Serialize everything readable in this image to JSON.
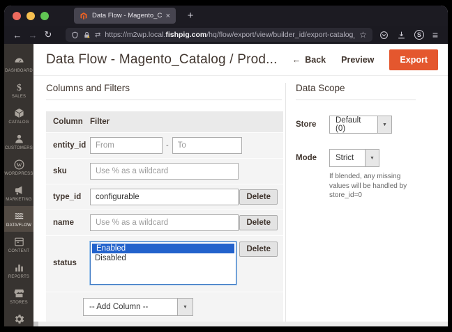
{
  "browser": {
    "tab_title": "Data Flow - Magento_Catalog / ...",
    "tab_close": "×",
    "new_tab": "+",
    "back": "←",
    "forward": "→",
    "reload": "↻",
    "exchange": "⇄",
    "url_prefix": "https://m2wp.local.",
    "url_domain": "fishpig.com",
    "url_path": "/hq/flow/export/view/builder_id/export-catalog_product/key/",
    "bookmark_star": "☆",
    "extension_s": "S",
    "menu": "≡"
  },
  "sidebar": {
    "items": [
      {
        "label": "DASHBOARD"
      },
      {
        "label": "SALES"
      },
      {
        "label": "CATALOG"
      },
      {
        "label": "CUSTOMERS"
      },
      {
        "label": "WORDPRESS"
      },
      {
        "label": "MARKETING"
      },
      {
        "label": "DATA/FLOW",
        "active": true
      },
      {
        "label": "CONTENT"
      },
      {
        "label": "REPORTS"
      },
      {
        "label": "STORES"
      },
      {
        "label": "SYSTEM"
      }
    ]
  },
  "header": {
    "title": "Data Flow - Magento_Catalog / Prod...",
    "back_arrow": "←",
    "back": "Back",
    "preview": "Preview",
    "export": "Export"
  },
  "columns": {
    "title": "Columns and Filters",
    "col_header": "Column",
    "filter_header": "Filter",
    "rows": {
      "entity_id": {
        "label": "entity_id",
        "from_placeholder": "From",
        "separator": "-",
        "to_placeholder": "To"
      },
      "sku": {
        "label": "sku",
        "placeholder": "Use % as a wildcard"
      },
      "type_id": {
        "label": "type_id",
        "value": "configurable",
        "delete": "Delete"
      },
      "name": {
        "label": "name",
        "placeholder": "Use % as a wildcard",
        "delete": "Delete"
      },
      "status": {
        "label": "status",
        "options": [
          "Enabled",
          "Disabled"
        ],
        "selected": "Enabled",
        "delete": "Delete"
      }
    },
    "add_column": "-- Add Column --",
    "dropdown_arrow": "▼"
  },
  "data_scope": {
    "title": "Data Scope",
    "store_label": "Store",
    "store_value": "Default (0)",
    "mode_label": "Mode",
    "mode_value": "Strict",
    "mode_help": "If blended, any missing values will be handled by store_id=0",
    "dropdown_arrow": "▼"
  },
  "colors": {
    "export_button": "#e4572e",
    "selection_blue": "#2262cc",
    "sidebar_bg": "#373330",
    "sidebar_active_bg": "#524a43"
  }
}
